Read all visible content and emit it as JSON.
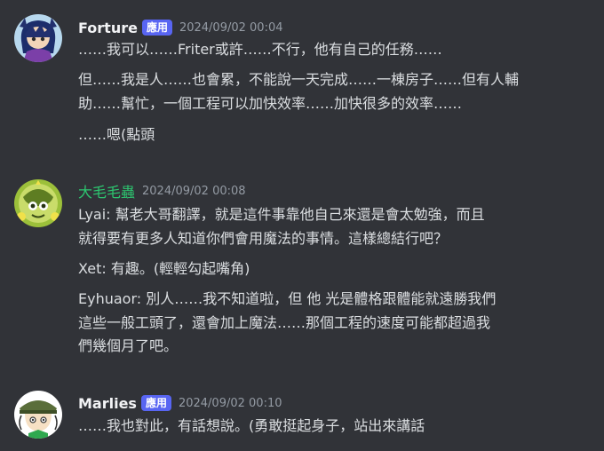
{
  "messages": [
    {
      "username": "Forture",
      "badge": "應用",
      "timestamp": "2024/09/02 00:04",
      "lines": [
        "……我可以……Friter或許……不行，他有自己的任務……",
        "但……我是人……也會累，不能說一天完成……一棟房子……但有人輔",
        "助……幫忙，一個工程可以加快效率……加快很多的效率……",
        "……嗯(點頭"
      ]
    },
    {
      "username": "大毛毛蟲",
      "timestamp": "2024/09/02 00:08",
      "lines": [
        "Lyai: 幫老大哥翻譯，就是這件事靠他自己來還是會太勉強，而且",
        "就得要有更多人知道你們會用魔法的事情。這樣總結行吧？",
        "Xet: 有趣。(輕輕勾起嘴角)",
        "Eyhuaor: 別人……我不知道啦，但 他 光是體格跟體能就遠勝我們",
        "這些一般工頭了，還會加上魔法……那個工程的速度可能都超過我",
        "們幾個月了吧。"
      ]
    },
    {
      "username": "Marlies",
      "badge": "應用",
      "timestamp": "2024/09/02 00:10",
      "lines": [
        "……我也對此，有話想說。(勇敢挺起身子，站出來講話"
      ]
    }
  ]
}
